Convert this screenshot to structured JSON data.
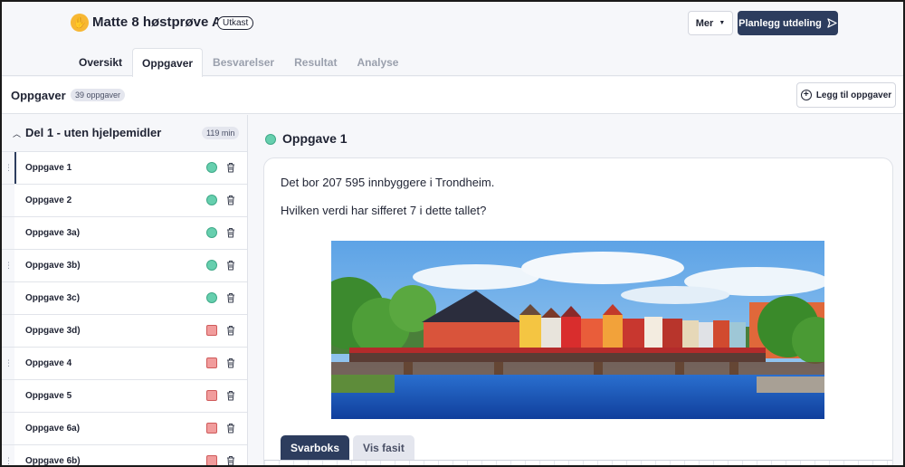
{
  "header": {
    "title": "Matte 8 høstprøve A",
    "status_badge": "Utkast",
    "more_label": "Mer",
    "plan_label": "Planlegg utdeling"
  },
  "tabs": [
    {
      "label": "Oversikt",
      "active": false
    },
    {
      "label": "Oppgaver",
      "active": true
    },
    {
      "label": "Besvarelser",
      "active": false
    },
    {
      "label": "Resultat",
      "active": false
    },
    {
      "label": "Analyse",
      "active": false
    }
  ],
  "subheader": {
    "title": "Oppgaver",
    "count": "39 oppgaver",
    "add_label": "Legg til oppgaver"
  },
  "sidebar": {
    "section_title": "Del 1 - uten hjelpemidler",
    "section_time": "119 min",
    "tasks": [
      {
        "label": "Oppgave 1",
        "status": "done"
      },
      {
        "label": "Oppgave 2",
        "status": "done"
      },
      {
        "label": "Oppgave 3a)",
        "status": "done"
      },
      {
        "label": "Oppgave 3b)",
        "status": "done"
      },
      {
        "label": "Oppgave 3c)",
        "status": "done"
      },
      {
        "label": "Oppgave 3d)",
        "status": "todo"
      },
      {
        "label": "Oppgave 4",
        "status": "todo"
      },
      {
        "label": "Oppgave 5",
        "status": "todo"
      },
      {
        "label": "Oppgave 6a)",
        "status": "todo"
      },
      {
        "label": "Oppgave 6b)",
        "status": "todo"
      }
    ]
  },
  "main": {
    "task_title": "Oppgave 1",
    "question_line_1": "Det bor 207 595 innbyggere i Trondheim.",
    "question_line_2": "Hvilken verdi har sifferet 7 i dette tallet?",
    "answer_tab_active": "Svarboks",
    "answer_tab_inactive": "Vis fasit"
  },
  "colors": {
    "primary": "#2d3d5e",
    "done": "#66cfae",
    "todo": "#f19c9c"
  }
}
